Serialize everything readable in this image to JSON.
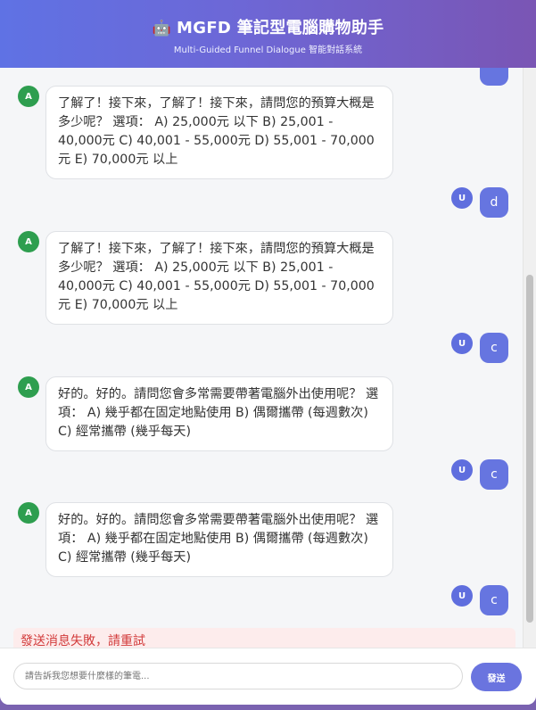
{
  "header": {
    "robot_glyph": "🤖",
    "title": "MGFD 筆記型電腦購物助手",
    "subtitle": "Multi-Guided Funnel Dialogue 智能對話系統"
  },
  "assistant_avatar_label": "A",
  "user_avatar_label": "U",
  "messages": [
    {
      "role": "assistant",
      "text": "了解了！接下來，了解了！接下來，請問您的預算大概是多少呢？ 選項： A) 25,000元 以下 B) 25,001 - 40,000元 C) 40,001 - 55,000元 D) 55,001 - 70,000元 E) 70,000元 以上"
    },
    {
      "role": "user",
      "text": "d"
    },
    {
      "role": "assistant",
      "text": "了解了！接下來，了解了！接下來，請問您的預算大概是多少呢？ 選項： A) 25,000元 以下 B) 25,001 - 40,000元 C) 40,001 - 55,000元 D) 55,001 - 70,000元 E) 70,000元 以上"
    },
    {
      "role": "user",
      "text": "c"
    },
    {
      "role": "assistant",
      "text": "好的。好的。請問您會多常需要帶著電腦外出使用呢？ 選項： A) 幾乎都在固定地點使用 B) 偶爾攜帶 (每週數次) C) 經常攜帶 (幾乎每天)"
    },
    {
      "role": "user",
      "text": "c"
    },
    {
      "role": "assistant",
      "text": "好的。好的。請問您會多常需要帶著電腦外出使用呢？ 選項： A) 幾乎都在固定地點使用 B) 偶爾攜帶 (每週數次) C) 經常攜帶 (幾乎每天)"
    },
    {
      "role": "user",
      "text": "c"
    }
  ],
  "error_text": "發送消息失敗，請重試",
  "input": {
    "placeholder": "請告訴我您想要什麼樣的筆電...",
    "value": ""
  },
  "send_label": "發送",
  "colors": {
    "header_start": "#5f72e4",
    "header_end": "#7a55b4",
    "assistant_avatar": "#2e9e4f",
    "user_bubble": "#6675e0",
    "error_text": "#d23b3b",
    "error_bg": "#fdecec"
  }
}
